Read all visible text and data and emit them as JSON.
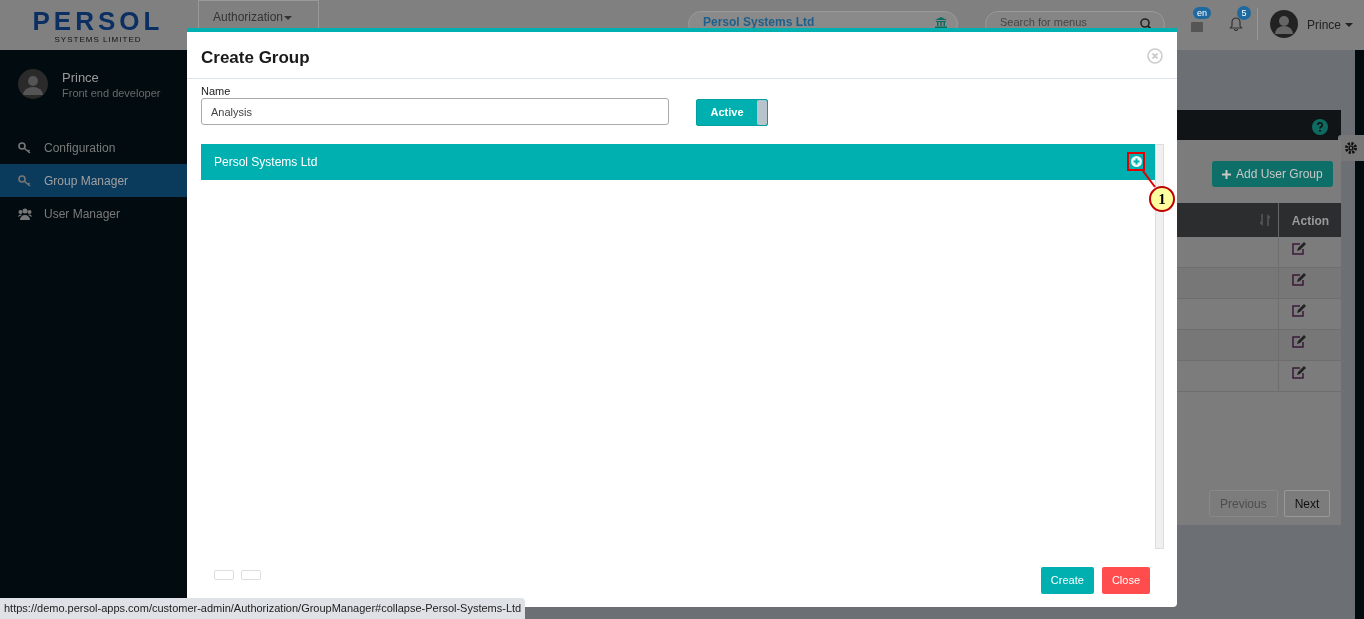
{
  "header": {
    "logo": "PERSOL",
    "logo_subtitle": "SYSTEMS LIMITED",
    "nav_tab": "Authorization",
    "company": "Persol Systems Ltd",
    "search": {
      "placeholder": "Search for menus"
    },
    "language_badge": "en",
    "notification_count": "5",
    "user": "Prince"
  },
  "sidebar": {
    "profile": {
      "name": "Prince",
      "role": "Front end developer"
    },
    "items": [
      {
        "label": "Configuration",
        "kind": "key",
        "selected": false
      },
      {
        "label": "Group Manager",
        "kind": "key",
        "selected": true
      },
      {
        "label": "User Manager",
        "kind": "users",
        "selected": false
      }
    ]
  },
  "panel": {
    "add_button": "Add User Group",
    "table": {
      "columns": [
        "Action"
      ],
      "rows": [
        {
          "kind": "edit"
        },
        {
          "kind": "edit"
        },
        {
          "kind": "edit"
        },
        {
          "kind": "edit"
        },
        {
          "kind": "edit"
        }
      ]
    },
    "pagination": [
      {
        "label": "Previous",
        "disabled": true
      },
      {
        "label": "Next",
        "disabled": false
      }
    ]
  },
  "modal": {
    "title": "Create Group",
    "name_field": {
      "label": "Name",
      "value": "Analysis"
    },
    "toggle": {
      "label": "Active",
      "on": true
    },
    "accordion": {
      "title": "Persol Systems Ltd",
      "expanded": false
    },
    "callout": "1",
    "buttons": [
      {
        "label": "Create",
        "kind": "primary"
      },
      {
        "label": "Close",
        "kind": "danger"
      }
    ]
  },
  "status_bar": {
    "url": "https://demo.persol-apps.com/customer-admin/Authorization/GroupManager#collapse-Persol-Systems-Ltd"
  }
}
